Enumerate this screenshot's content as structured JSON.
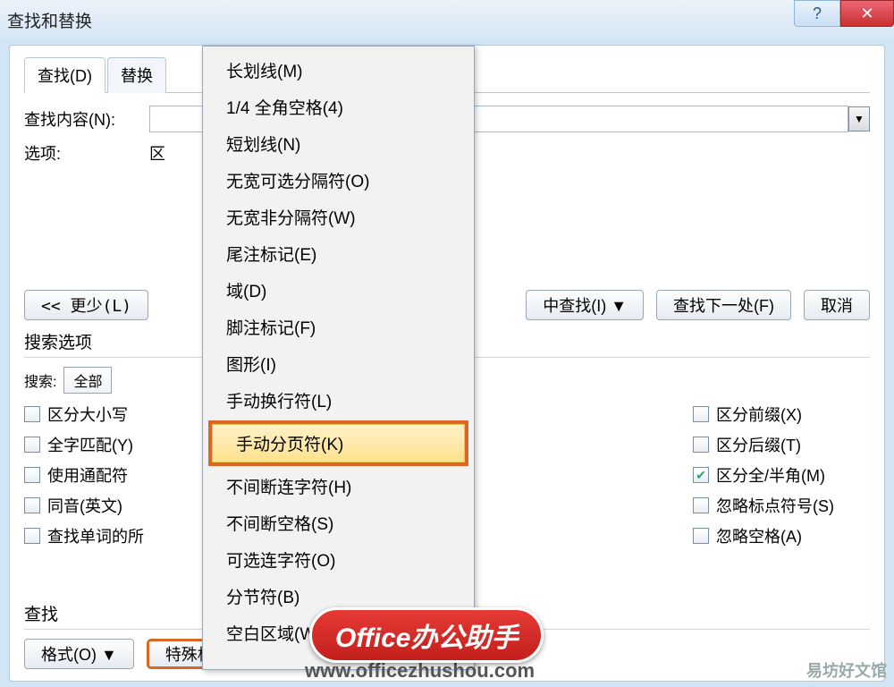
{
  "window": {
    "title": "查找和替换"
  },
  "tabs": {
    "find": "查找(D)",
    "replace": "替换"
  },
  "find": {
    "content_label": "查找内容(N):",
    "options_label": "选项:",
    "options_value": "区"
  },
  "buttons": {
    "less": "<< 更少(L)",
    "reading_highlight": "中查找(I) ▼",
    "find_next": "查找下一处(F)",
    "cancel": "取消",
    "format": "格式(O) ▼",
    "special": "特殊格式(E) ▼"
  },
  "search_options": {
    "title": "搜索选项",
    "search_label": "搜索:",
    "search_value": "全部",
    "left": [
      "区分大小写",
      "全字匹配(Y)",
      "使用通配符",
      "同音(英文)",
      "查找单词的所"
    ],
    "right": [
      {
        "label": "区分前缀(X)",
        "checked": false
      },
      {
        "label": "区分后缀(T)",
        "checked": false
      },
      {
        "label": "区分全/半角(M)",
        "checked": true
      },
      {
        "label": "忽略标点符号(S)",
        "checked": false
      },
      {
        "label": "忽略空格(A)",
        "checked": false
      }
    ]
  },
  "find_section": {
    "title": "查找"
  },
  "menu": {
    "items_top": [
      "长划线(M)",
      "1/4 全角空格(4)",
      "短划线(N)",
      "无宽可选分隔符(O)",
      "无宽非分隔符(W)",
      "尾注标记(E)",
      "域(D)",
      "脚注标记(F)",
      "图形(I)",
      "手动换行符(L)"
    ],
    "highlight": "手动分页符(K)",
    "items_bottom": [
      "不间断连字符(H)",
      "不间断空格(S)",
      "可选连字符(O)",
      "分节符(B)",
      "空白区域(W)"
    ]
  },
  "badge": "Office办公助手",
  "url": "www.officezhushou.com",
  "watermark": "易坊好文馆"
}
